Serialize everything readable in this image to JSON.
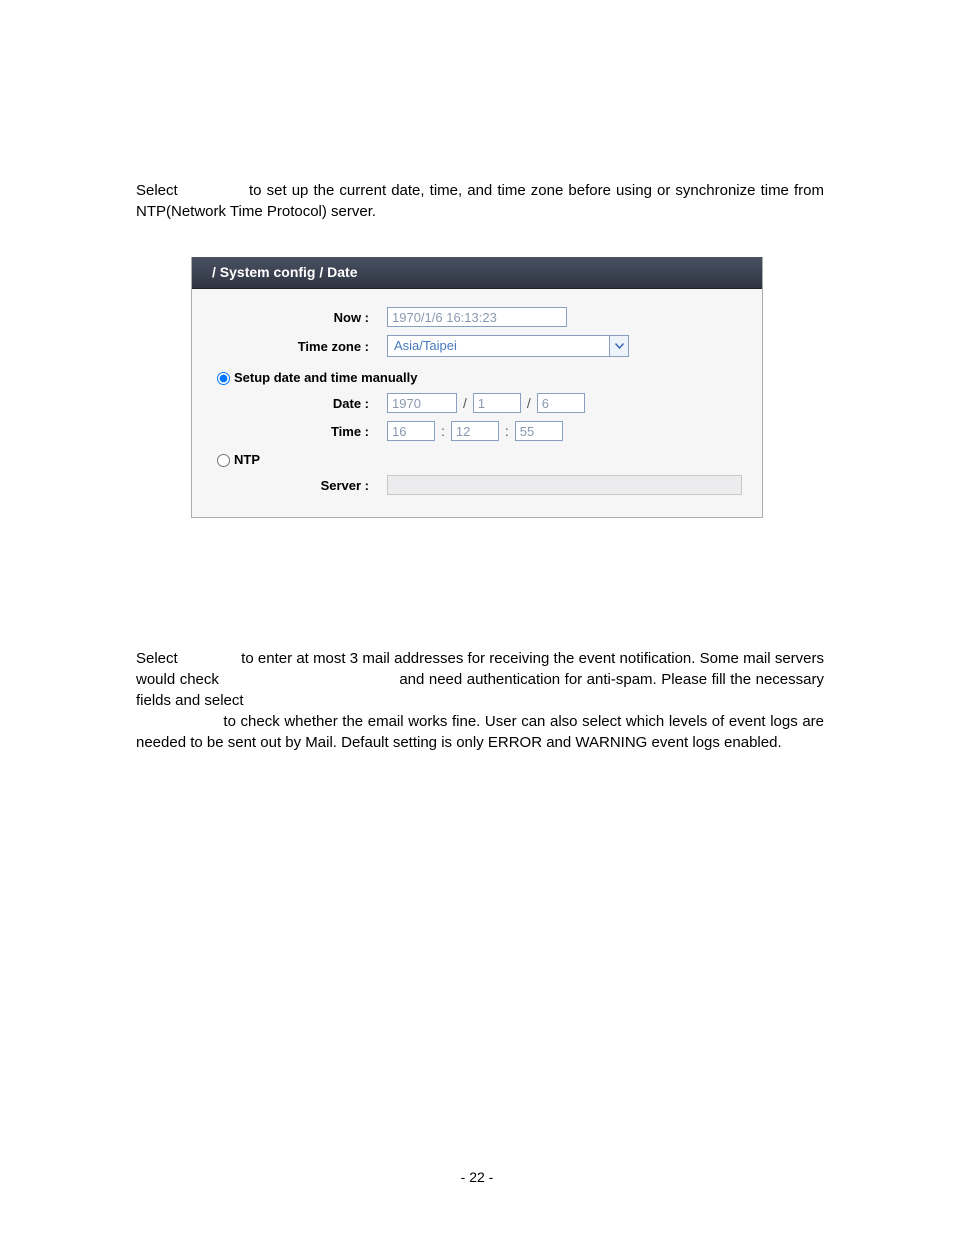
{
  "para1": "Select              to set up the current date, time, and time zone before using or synchronize time from NTP(Network Time Protocol) server.",
  "panel": {
    "title": "/ System config / Date",
    "now_label": "Now :",
    "now_value": "1970/1/6 16:13:23",
    "tz_label": "Time zone :",
    "tz_value": "Asia/Taipei",
    "manual_label": "Setup date and time manually",
    "date_label": "Date :",
    "date_y": "1970",
    "date_m": "1",
    "date_d": "6",
    "time_label": "Time :",
    "time_h": "16",
    "time_m": "12",
    "time_s": "55",
    "ntp_label": "NTP",
    "server_label": "Server :",
    "server_value": ""
  },
  "para2": "Select               to enter at most 3 mail addresses for receiving the event notification. Some mail servers would check                                        and need authentication for anti-spam. Please fill the necessary fields and select",
  "para3": "                   to check whether the email works fine. User can also select which levels of event logs are needed to be sent out by Mail. Default setting is only ERROR and WARNING event logs enabled.",
  "page_number": "- 22 -"
}
